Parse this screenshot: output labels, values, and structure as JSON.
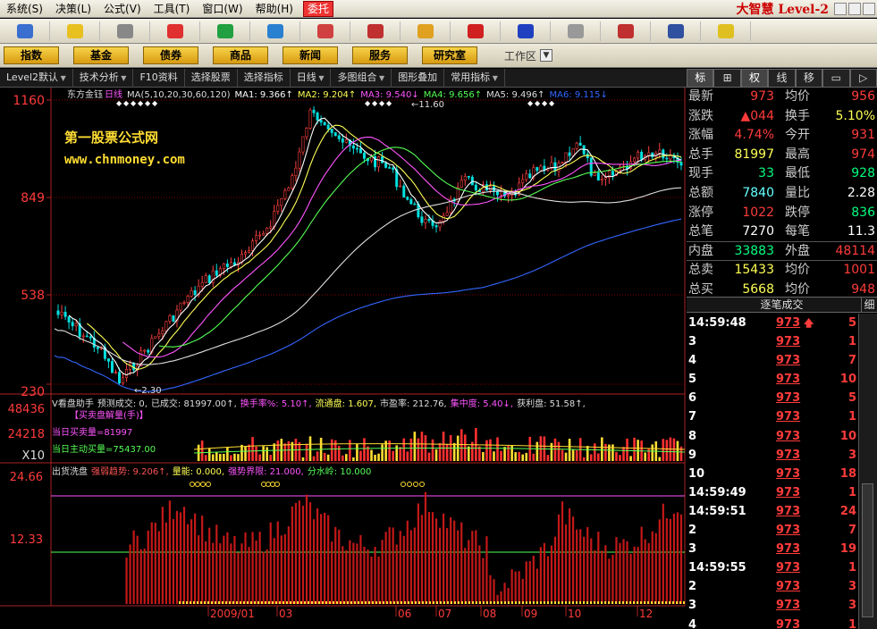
{
  "menu": {
    "items": [
      "系统(S)",
      "决策(L)",
      "公式(V)",
      "工具(T)",
      "窗口(W)",
      "帮助(H)"
    ],
    "consign": "委托",
    "brand": "大智慧 Level-2"
  },
  "toolbar": {
    "icons": [
      "grid-icon",
      "cross-icon",
      "ruler-icon",
      "dollar-icon",
      "chain-icon",
      "globe-icon",
      "zoom-icon",
      "pin-icon",
      "diamond-icon",
      "shield-icon",
      "star-icon",
      "window-icon",
      "panel-icon",
      "books-icon",
      "help-icon"
    ]
  },
  "nav": {
    "buttons": [
      "指数",
      "基金",
      "债券",
      "商品",
      "新闻",
      "服务",
      "研究室"
    ],
    "workspace": "工作区"
  },
  "subbar": {
    "items": [
      {
        "label": "Level2默认",
        "arrow": true
      },
      {
        "label": "技术分析",
        "arrow": true
      },
      {
        "label": "F10资料",
        "arrow": false
      },
      {
        "label": "选择股票",
        "arrow": false
      },
      {
        "label": "选择指标",
        "arrow": false
      },
      {
        "label": "日线",
        "arrow": true
      },
      {
        "label": "多图组合",
        "arrow": true
      },
      {
        "label": "图形叠加",
        "arrow": false
      },
      {
        "label": "常用指标",
        "arrow": true
      }
    ]
  },
  "right_tabs": [
    "标",
    "⊞",
    "权",
    "线",
    "移",
    "▭",
    "▷"
  ],
  "main_chart": {
    "stock_name": "东方金钰",
    "period": "日线",
    "ma_legend": [
      {
        "text": "MA(5,10,20,30,60,120)",
        "color": "#dddddd"
      },
      {
        "text": "MA1: 9.366↑",
        "color": "#ffffff"
      },
      {
        "text": "MA2: 9.204↑",
        "color": "#ffff55"
      },
      {
        "text": "MA3: 9.540↓",
        "color": "#ff55ff"
      },
      {
        "text": "MA4: 9.656↑",
        "color": "#55ff55"
      },
      {
        "text": "MA5: 9.496↑",
        "color": "#dddddd"
      },
      {
        "text": "MA6: 9.115↓",
        "color": "#3366ff"
      }
    ],
    "y_labels": [
      "1160",
      "849",
      "538",
      "230"
    ],
    "high_label": "11.60",
    "low_label": "2.30",
    "watermark_title": "第一股票公式网",
    "watermark_url": "www.chnmoney.com"
  },
  "volume_panel": {
    "header": [
      {
        "text": "V看盘助手",
        "color": "#dddddd"
      },
      {
        "text": "预测成交: 0,",
        "color": "#dddddd"
      },
      {
        "text": "已成交: 81997.00↑,",
        "color": "#dddddd"
      },
      {
        "text": "换手率%: 5.10↑,",
        "color": "#ff55ff"
      },
      {
        "text": "流通盘: 1.607,",
        "color": "#ffff55"
      },
      {
        "text": "市盈率: 212.76,",
        "color": "#dddddd"
      },
      {
        "text": "集中度: 5.40↓,",
        "color": "#ff55ff"
      },
      {
        "text": "获利盘: 51.58↑,",
        "color": "#dddddd"
      }
    ],
    "sub_title": "【买卖盘解量(手)】",
    "buy_volume": "当日买卖量=81997",
    "active_buy": "当日主动买量=75437.00",
    "y_labels": [
      "48436",
      "24218",
      "X10"
    ]
  },
  "indicator_panel": {
    "header": [
      {
        "text": "出货洗盘",
        "color": "#dddddd"
      },
      {
        "text": "强弱趋势: 9.206↑,",
        "color": "#ff5555"
      },
      {
        "text": "量能: 0.000,",
        "color": "#ffff55"
      },
      {
        "text": "强势界限: 21.000,",
        "color": "#ff55ff"
      },
      {
        "text": "分水岭: 10.000",
        "color": "#55ff55"
      }
    ],
    "y_labels": [
      "24.66",
      "12.33"
    ]
  },
  "x_axis": {
    "labels": [
      "2009/01",
      "03",
      "06",
      "07",
      "08",
      "09",
      "10",
      "12"
    ]
  },
  "quote": {
    "rows": [
      {
        "l1": "最新",
        "v1": "973",
        "c1": "red",
        "l2": "均价",
        "v2": "956",
        "c2": "red"
      },
      {
        "l1": "涨跌",
        "v1": "▲044",
        "c1": "red",
        "l2": "换手",
        "v2": "5.10%",
        "c2": "yellow"
      },
      {
        "l1": "涨幅",
        "v1": "4.74%",
        "c1": "red",
        "l2": "今开",
        "v2": "931",
        "c2": "red"
      },
      {
        "l1": "总手",
        "v1": "81997",
        "c1": "yellow",
        "l2": "最高",
        "v2": "974",
        "c2": "red"
      },
      {
        "l1": "现手",
        "v1": "33",
        "c1": "green",
        "l2": "最低",
        "v2": "928",
        "c2": "green"
      },
      {
        "l1": "总额",
        "v1": "7840",
        "c1": "cyan",
        "l2": "量比",
        "v2": "2.28",
        "c2": "white"
      },
      {
        "l1": "涨停",
        "v1": "1022",
        "c1": "red",
        "l2": "跌停",
        "v2": "836",
        "c2": "green"
      },
      {
        "l1": "总笔",
        "v1": "7270",
        "c1": "white",
        "l2": "每笔",
        "v2": "11.3",
        "c2": "white"
      },
      {
        "l1": "内盘",
        "v1": "33883",
        "c1": "green",
        "l2": "外盘",
        "v2": "48114",
        "c2": "red"
      },
      {
        "l1": "总卖",
        "v1": "15433",
        "c1": "yellow",
        "l2": "均价",
        "v2": "1001",
        "c2": "red"
      },
      {
        "l1": "总买",
        "v1": "5668",
        "c1": "yellow",
        "l2": "均价",
        "v2": "948",
        "c2": "red"
      }
    ]
  },
  "ticks": {
    "title": "逐笔成交",
    "detail": "细",
    "rows": [
      {
        "time": "14:59:48",
        "price": "973",
        "arrow": "🡅",
        "vol": "5"
      },
      {
        "time": "3",
        "price": "973",
        "arrow": "",
        "vol": "1"
      },
      {
        "time": "4",
        "price": "973",
        "arrow": "",
        "vol": "7"
      },
      {
        "time": "5",
        "price": "973",
        "arrow": "",
        "vol": "10"
      },
      {
        "time": "6",
        "price": "973",
        "arrow": "",
        "vol": "5"
      },
      {
        "time": "7",
        "price": "973",
        "arrow": "",
        "vol": "1"
      },
      {
        "time": "8",
        "price": "973",
        "arrow": "",
        "vol": "10"
      },
      {
        "time": "9",
        "price": "973",
        "arrow": "",
        "vol": "3"
      },
      {
        "time": "10",
        "price": "973",
        "arrow": "",
        "vol": "18"
      },
      {
        "time": "14:59:49",
        "price": "973",
        "arrow": "",
        "vol": "1"
      },
      {
        "time": "14:59:51",
        "price": "973",
        "arrow": "",
        "vol": "24"
      },
      {
        "time": "2",
        "price": "973",
        "arrow": "",
        "vol": "7"
      },
      {
        "time": "3",
        "price": "973",
        "arrow": "",
        "vol": "19"
      },
      {
        "time": "14:59:55",
        "price": "973",
        "arrow": "",
        "vol": "1"
      },
      {
        "time": "2",
        "price": "973",
        "arrow": "",
        "vol": "3"
      },
      {
        "time": "3",
        "price": "973",
        "arrow": "",
        "vol": "3"
      },
      {
        "time": "4",
        "price": "973",
        "arrow": "",
        "vol": "1"
      }
    ]
  },
  "colors": {
    "up": "#ff3b3b",
    "down": "#00ff7f",
    "grid": "#880000",
    "axis": "#aa2222"
  }
}
